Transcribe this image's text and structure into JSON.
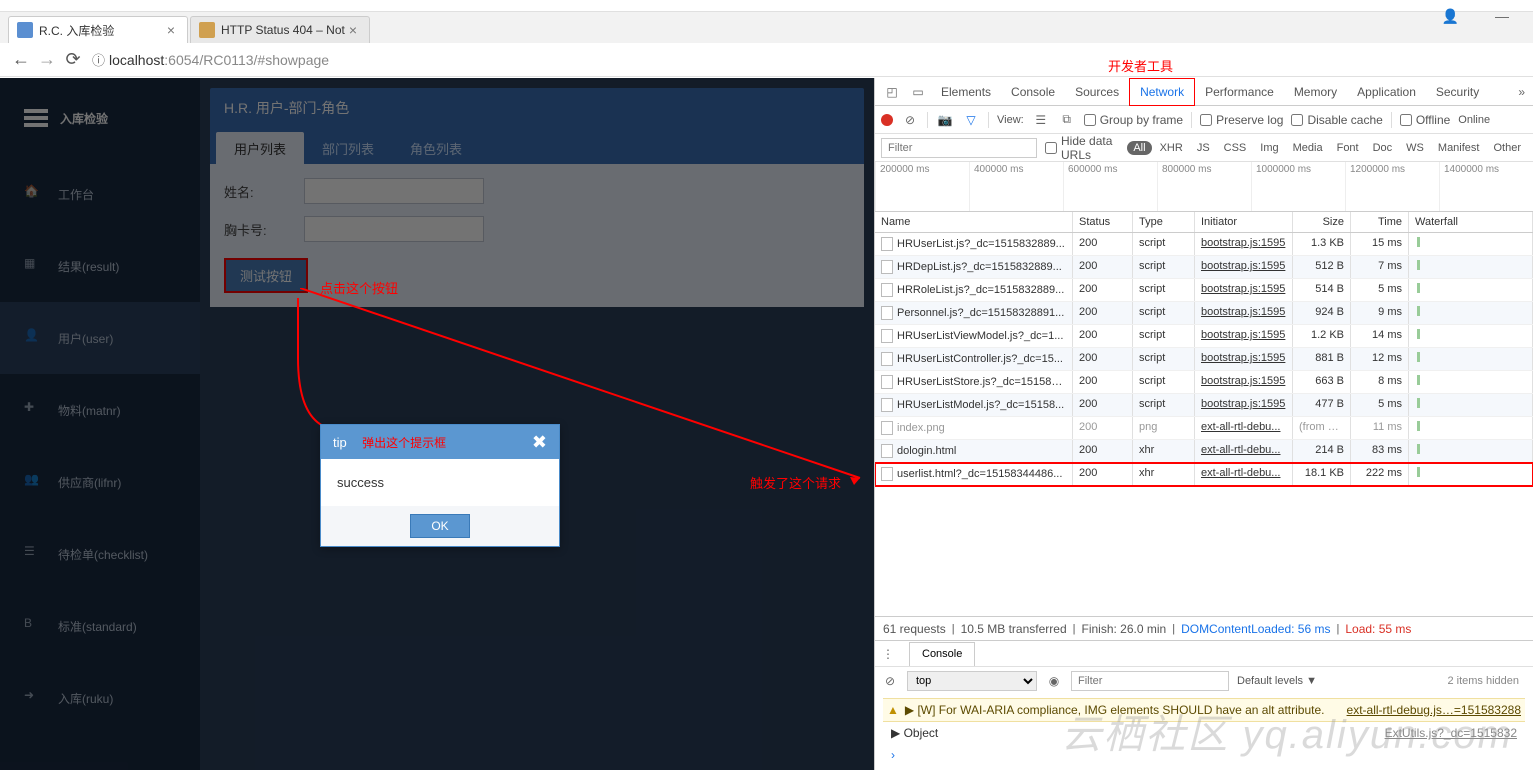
{
  "browser": {
    "tabs": [
      {
        "title": "R.C. 入库检验",
        "active": true
      },
      {
        "title": "HTTP Status 404 – Not",
        "active": false
      }
    ],
    "url_host": "localhost",
    "url_port": ":6054",
    "url_path": "/RC0113/#showpage",
    "window_controls": {
      "account": "👤",
      "min": "—",
      "close": "✕"
    }
  },
  "annotations": {
    "devtools_label": "开发者工具",
    "click_btn": "点击这个按钮",
    "popup": "弹出这个提示框",
    "triggered": "触发了这个请求"
  },
  "app": {
    "brand": "入库检验",
    "menu": [
      {
        "icon": "home",
        "label": "工作台"
      },
      {
        "icon": "grid",
        "label": "结果(result)"
      },
      {
        "icon": "user",
        "label": "用户(user)",
        "active": true
      },
      {
        "icon": "puzzle",
        "label": "物料(matnr)"
      },
      {
        "icon": "group",
        "label": "供应商(lifnr)"
      },
      {
        "icon": "list",
        "label": "待检单(checklist)"
      },
      {
        "icon": "bold",
        "label": "标准(standard)"
      },
      {
        "icon": "export",
        "label": "入库(ruku)"
      }
    ],
    "panel_title": "H.R. 用户-部门-角色",
    "panel_tabs": [
      "用户列表",
      "部门列表",
      "角色列表"
    ],
    "form": {
      "name_label": "姓名:",
      "card_label": "胸卡号:"
    },
    "test_button": "测试按钮",
    "dialog": {
      "title": "tip",
      "body": "success",
      "ok": "OK"
    }
  },
  "devtools": {
    "tabs": [
      "Elements",
      "Console",
      "Sources",
      "Network",
      "Performance",
      "Memory",
      "Application",
      "Security"
    ],
    "active_tab": "Network",
    "toolbar": {
      "view_label": "View:",
      "group": "Group by frame",
      "preserve": "Preserve log",
      "disable_cache": "Disable cache",
      "offline": "Offline",
      "online": "Online"
    },
    "filter": {
      "placeholder": "Filter",
      "hide_urls": "Hide data URLs",
      "chips": [
        "All",
        "XHR",
        "JS",
        "CSS",
        "Img",
        "Media",
        "Font",
        "Doc",
        "WS",
        "Manifest",
        "Other"
      ]
    },
    "timeline_ticks": [
      "200000 ms",
      "400000 ms",
      "600000 ms",
      "800000 ms",
      "1000000 ms",
      "1200000 ms",
      "1400000 ms"
    ],
    "columns": [
      "Name",
      "Status",
      "Type",
      "Initiator",
      "Size",
      "Time",
      "Waterfall"
    ],
    "rows": [
      {
        "name": "HRUserList.js?_dc=1515832889...",
        "status": "200",
        "type": "script",
        "init": "bootstrap.js:1595",
        "size": "1.3 KB",
        "time": "15 ms"
      },
      {
        "name": "HRDepList.js?_dc=1515832889...",
        "status": "200",
        "type": "script",
        "init": "bootstrap.js:1595",
        "size": "512 B",
        "time": "7 ms"
      },
      {
        "name": "HRRoleList.js?_dc=1515832889...",
        "status": "200",
        "type": "script",
        "init": "bootstrap.js:1595",
        "size": "514 B",
        "time": "5 ms"
      },
      {
        "name": "Personnel.js?_dc=15158328891...",
        "status": "200",
        "type": "script",
        "init": "bootstrap.js:1595",
        "size": "924 B",
        "time": "9 ms"
      },
      {
        "name": "HRUserListViewModel.js?_dc=1...",
        "status": "200",
        "type": "script",
        "init": "bootstrap.js:1595",
        "size": "1.2 KB",
        "time": "14 ms"
      },
      {
        "name": "HRUserListController.js?_dc=15...",
        "status": "200",
        "type": "script",
        "init": "bootstrap.js:1595",
        "size": "881 B",
        "time": "12 ms"
      },
      {
        "name": "HRUserListStore.js?_dc=151583...",
        "status": "200",
        "type": "script",
        "init": "bootstrap.js:1595",
        "size": "663 B",
        "time": "8 ms"
      },
      {
        "name": "HRUserListModel.js?_dc=15158...",
        "status": "200",
        "type": "script",
        "init": "bootstrap.js:1595",
        "size": "477 B",
        "time": "5 ms"
      },
      {
        "name": "index.png",
        "status": "200",
        "type": "png",
        "init": "ext-all-rtl-debu...",
        "size": "(from di...",
        "time": "11 ms",
        "grey": true
      },
      {
        "name": "dologin.html",
        "status": "200",
        "type": "xhr",
        "init": "ext-all-rtl-debu...",
        "size": "214 B",
        "time": "83 ms"
      },
      {
        "name": "userlist.html?_dc=15158344486...",
        "status": "200",
        "type": "xhr",
        "init": "ext-all-rtl-debu...",
        "size": "18.1 KB",
        "time": "222 ms",
        "boxed": true
      }
    ],
    "summary": {
      "requests": "61 requests",
      "transferred": "10.5 MB transferred",
      "finish": "Finish: 26.0 min",
      "dom": "DOMContentLoaded: 56 ms",
      "load": "Load: 55 ms"
    },
    "console_tab": "Console",
    "console_ctx": "top",
    "console_filter": "Filter",
    "console_levels": "Default levels ▼",
    "console_hidden": "2 items hidden",
    "console_warn": "[W] For WAI-ARIA compliance, IMG elements SHOULD have an alt attribute.",
    "console_warn_link": "ext-all-rtl-debug.js…=151583288",
    "console_obj": "▶ Object",
    "console_obj_link": "ExtUtils.js?_dc=1515832",
    "console_prompt": "›"
  },
  "watermark": "云栖社区 yq.aliyun.com"
}
